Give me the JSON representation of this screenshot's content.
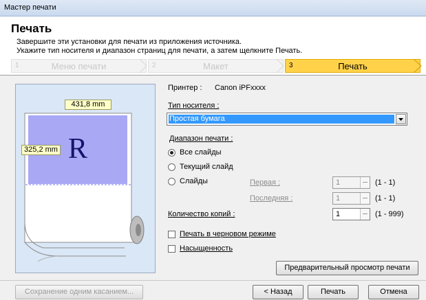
{
  "window": {
    "title": "Мастер печати"
  },
  "header": {
    "title": "Печать",
    "desc_line1": "Завершите эти установки для печати из приложения источника.",
    "desc_line2": "Укажите тип носителя и диапазон страниц для печати, а затем щелкните Печать."
  },
  "steps": [
    {
      "num": "1",
      "label": "Меню печати"
    },
    {
      "num": "2",
      "label": "Макет"
    },
    {
      "num": "3",
      "label": "Печать"
    }
  ],
  "preview": {
    "width_label": "431,8 mm",
    "height_label": "325,2 mm",
    "glyph": "R"
  },
  "printer": {
    "label": "Принтер :",
    "name": "Canon iPFxxxx"
  },
  "media": {
    "label": "Тип носителя :",
    "value": "Простая бумага"
  },
  "range": {
    "label": "Диапазон печати :",
    "all": "Все слайды",
    "current": "Текущий слайд",
    "slides": "Слайды",
    "first_label": "Первая :",
    "last_label": "Последняя :",
    "first_value": "1",
    "last_value": "1",
    "first_hint": "(1 - 1)",
    "last_hint": "(1 - 1)"
  },
  "copies": {
    "label": "Количество копий :",
    "value": "1",
    "hint": "(1 - 999)"
  },
  "options": {
    "draft": "Печать в черновом режиме",
    "saturation": "Насыщенность"
  },
  "buttons": {
    "preview": "Предварительный просмотр печати",
    "one_touch": "Сохранение одним касанием...",
    "back": "< Назад",
    "print": "Печать",
    "cancel": "Отмена"
  },
  "colors": {
    "active_step": "#ffd24a",
    "paper_fill": "#a8a8f5",
    "selection": "#3399ff",
    "preview_bg": "#dae7f6"
  }
}
